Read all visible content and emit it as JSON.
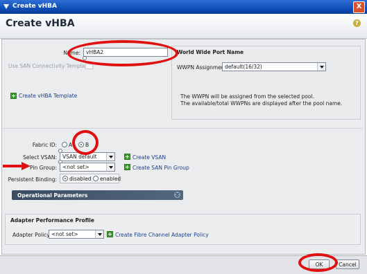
{
  "window": {
    "title": "Create vHBA",
    "close_label": "X"
  },
  "header": {
    "title": "Create vHBA",
    "help_label": "?"
  },
  "form": {
    "name_label": "Name:",
    "name_value": "vHBA2",
    "san_template_label": "Use SAN Connectivity Template:",
    "create_template_link": "Create vHBA Template",
    "fabric_id_label": "Fabric ID:",
    "fabric_a_label": "A",
    "fabric_b_label": "B",
    "select_vsan_label": "Select VSAN:",
    "select_vsan_value": "VSAN default",
    "create_vsan_link": "Create VSAN",
    "pin_group_label": "Pin Group:",
    "pin_group_value": "<not set>",
    "create_pin_group_link": "Create SAN Pin Group",
    "persistent_binding_label": "Persistent Binding:",
    "persistent_disabled": "disabled",
    "persistent_enabled": "enabled",
    "operational_parameters": "Operational Parameters"
  },
  "wwpn": {
    "title": "World Wide Port Name",
    "assignment_label": "WWPN Assignment:",
    "assignment_value": "default(16/32)",
    "info_line1": "The WWPN will be assigned from the selected pool.",
    "info_line2": "The available/total WWPNs are displayed after the pool name."
  },
  "adapter": {
    "title": "Adapter Performance Profile",
    "policy_label": "Adapter Policy:",
    "policy_value": "<not set>",
    "create_policy_link": "Create Fibre Channel Adapter Policy"
  },
  "footer": {
    "ok_label": "OK",
    "cancel_label": "Cancel"
  },
  "colors": {
    "title_bar": "#0f4fb6",
    "annotation": "#e01010",
    "link": "#1f3f8f"
  }
}
